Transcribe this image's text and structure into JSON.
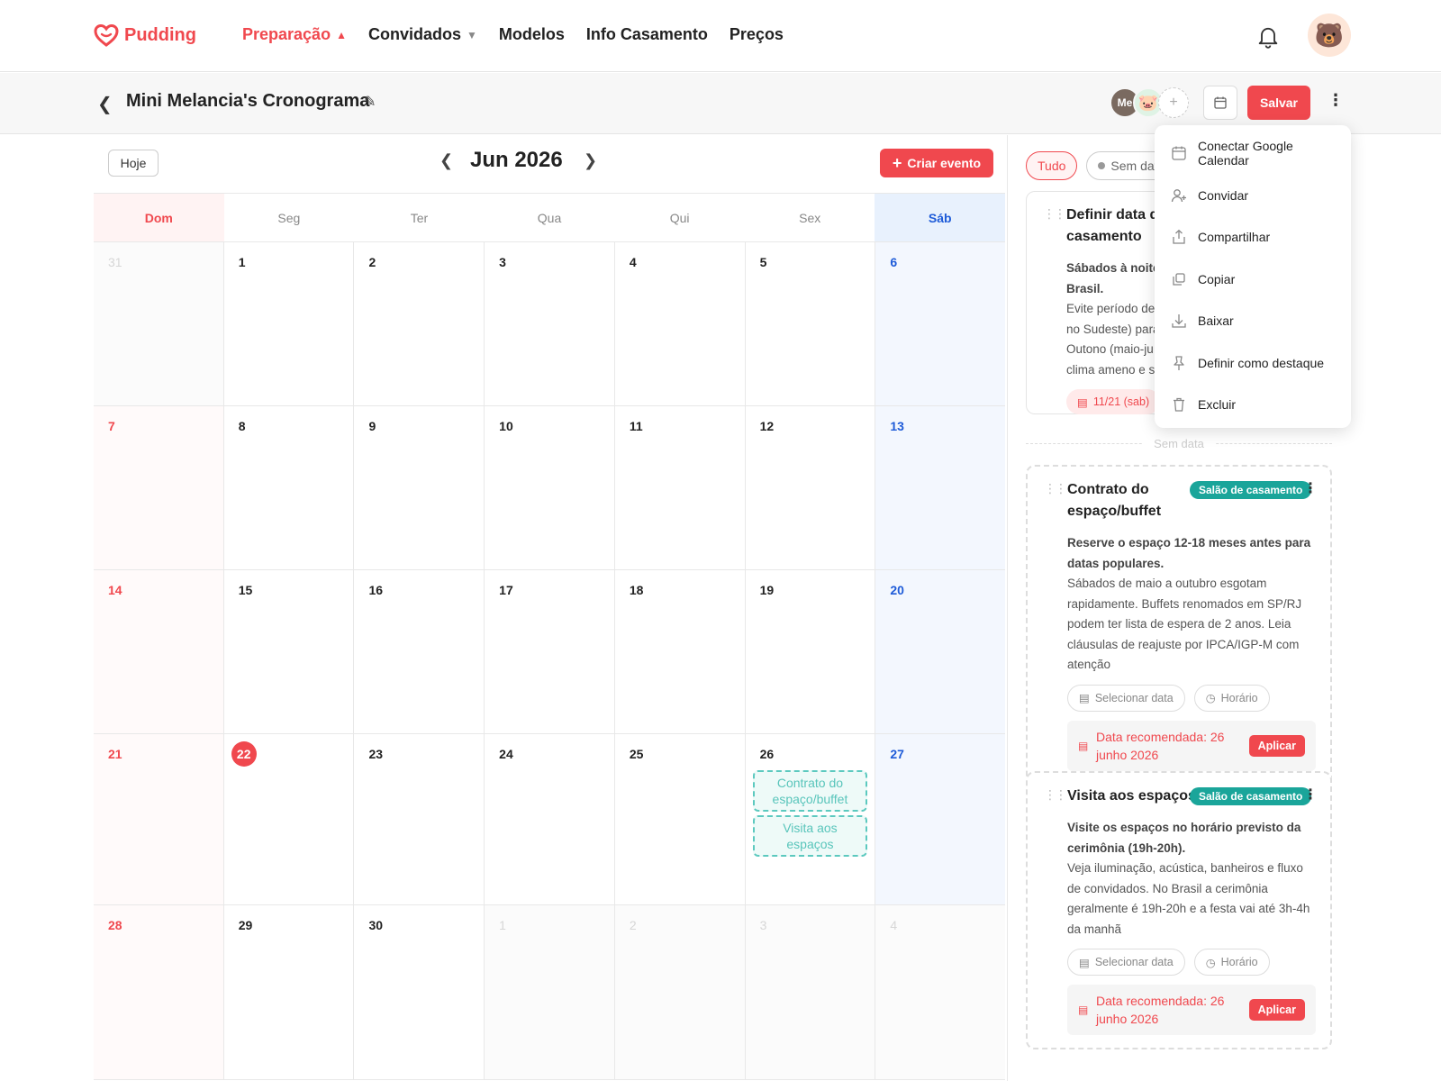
{
  "nav": {
    "brand": "Pudding",
    "items": [
      {
        "label": "Preparação",
        "active": true,
        "dropdown": true
      },
      {
        "label": "Convidados",
        "active": false,
        "dropdown": true
      },
      {
        "label": "Modelos",
        "active": false,
        "dropdown": false
      },
      {
        "label": "Info Casamento",
        "active": false,
        "dropdown": false
      },
      {
        "label": "Preços",
        "active": false,
        "dropdown": false
      }
    ],
    "icons": [
      "bell-icon",
      "user-avatar"
    ]
  },
  "subbar": {
    "title": "Mini Melancia's Cronograma",
    "collaborators": [
      "Me"
    ],
    "save_label": "Salvar"
  },
  "calendar": {
    "today_label": "Hoje",
    "month_label": "Jun 2026",
    "create_label": "Criar evento",
    "weekdays": [
      "Dom",
      "Seg",
      "Ter",
      "Qua",
      "Qui",
      "Sex",
      "Sáb"
    ],
    "weeks": [
      [
        {
          "d": "31",
          "o": true
        },
        {
          "d": "1"
        },
        {
          "d": "2"
        },
        {
          "d": "3"
        },
        {
          "d": "4"
        },
        {
          "d": "5"
        },
        {
          "d": "6"
        }
      ],
      [
        {
          "d": "7"
        },
        {
          "d": "8"
        },
        {
          "d": "9"
        },
        {
          "d": "10"
        },
        {
          "d": "11"
        },
        {
          "d": "12"
        },
        {
          "d": "13"
        }
      ],
      [
        {
          "d": "14"
        },
        {
          "d": "15"
        },
        {
          "d": "16"
        },
        {
          "d": "17"
        },
        {
          "d": "18"
        },
        {
          "d": "19"
        },
        {
          "d": "20"
        }
      ],
      [
        {
          "d": "21"
        },
        {
          "d": "22",
          "today": true
        },
        {
          "d": "23"
        },
        {
          "d": "24"
        },
        {
          "d": "25"
        },
        {
          "d": "26",
          "events": [
            "Contrato do espaço/buffet",
            "Visita aos espaços"
          ]
        },
        {
          "d": "27"
        }
      ],
      [
        {
          "d": "28"
        },
        {
          "d": "29"
        },
        {
          "d": "30"
        },
        {
          "d": "1",
          "o": true
        },
        {
          "d": "2",
          "o": true
        },
        {
          "d": "3",
          "o": true
        },
        {
          "d": "4",
          "o": true
        }
      ]
    ]
  },
  "sidebar": {
    "filters": [
      {
        "label": "Tudo",
        "active": true
      },
      {
        "label": "Sem dat",
        "active": false
      }
    ],
    "separator": "Sem data",
    "first_card": {
      "title": "Definir data d casamento",
      "desc_bold": "Sábados à noite Brasil.",
      "desc": "Evite período de no Sudeste) para Outono (maio-ju clima ameno e s",
      "date": "11/21 (sab)"
    },
    "cards": [
      {
        "title": "Contrato do espaço/buffet",
        "tag": "Salão de casamento",
        "desc_bold": "Reserve o espaço 12-18 meses antes para datas populares.",
        "desc": "Sábados de maio a outubro esgotam rapidamente. Buffets renomados em SP/RJ podem ter lista de espera de 2 anos. Leia cláusulas de reajuste por IPCA/IGP-M com atenção",
        "date_placeholder": "Selecionar data",
        "time_placeholder": "Horário",
        "recommendation": "Data recomendada: 26 junho 2026",
        "apply_label": "Aplicar"
      },
      {
        "title": "Visita aos espaços",
        "tag": "Salão de casamento",
        "desc_bold": "Visite os espaços no horário previsto da cerimônia (19h-20h).",
        "desc": "Veja iluminação, acústica, banheiros e fluxo de convidados. No Brasil a cerimônia geralmente é 19h-20h e a festa vai até 3h-4h da manhã",
        "date_placeholder": "Selecionar data",
        "time_placeholder": "Horário",
        "recommendation": "Data recomendada: 26 junho 2026",
        "apply_label": "Aplicar"
      }
    ]
  },
  "dropdown": {
    "items": [
      {
        "label": "Conectar Google Calendar",
        "icon": "calendar-icon"
      },
      {
        "label": "Convidar",
        "icon": "user-plus-icon"
      },
      {
        "label": "Compartilhar",
        "icon": "share-icon"
      },
      {
        "label": "Copiar",
        "icon": "copy-icon"
      },
      {
        "label": "Baixar",
        "icon": "download-icon"
      },
      {
        "label": "Definir como destaque",
        "icon": "pin-icon"
      },
      {
        "label": "Excluir",
        "icon": "trash-icon"
      }
    ]
  },
  "colors": {
    "accent": "#f0484e",
    "saturday": "#1e5bd8",
    "tag": "#1aa59a",
    "event": "#5cc9bf"
  }
}
